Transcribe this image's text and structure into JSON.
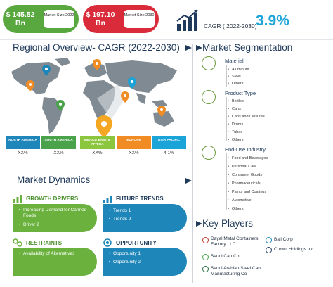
{
  "top": {
    "size_2022": {
      "value": "$ 145.52 Bn",
      "label": "Market Size 2022"
    },
    "size_2030": {
      "value": "$ 197.10 Bn",
      "label": "Market Size 2030"
    },
    "cagr_label": "CAGR ( 2022-2030)",
    "cagr_value": "3.9%"
  },
  "regional": {
    "title": "Regional Overview- CAGR (2022-2030)",
    "regions": [
      {
        "name": "NORTH AMERICA",
        "value": "XX%",
        "color": "#1e86b8"
      },
      {
        "name": "SOUTH AMERICA",
        "value": "XX%",
        "color": "#4aa24b"
      },
      {
        "name": "MIDDLE EAST & AFRICA",
        "value": "XX%",
        "color": "#8cc63f"
      },
      {
        "name": "EUROPE",
        "value": "XX%",
        "color": "#f08c23"
      },
      {
        "name": "ASIA PACIFIC",
        "value": "4.1%",
        "color": "#1aa4d8"
      }
    ]
  },
  "dynamics": {
    "title": "Market Dynamics",
    "growth_drivers": {
      "title": "GROWTH DRIVERS",
      "items": [
        "Increasing Demand for Canned Foods",
        "Driver 2"
      ],
      "color": "#6bb13e"
    },
    "future_trends": {
      "title": "FUTURE TRENDS",
      "items": [
        "Trends 1",
        "Trends 2"
      ],
      "color": "#1e86b8"
    },
    "restraints": {
      "title": "RESTRAINTS",
      "items": [
        "Availability of Alternatives"
      ],
      "color": "#6bb13e"
    },
    "opportunity": {
      "title": "OPPORTUNITY",
      "items": [
        "Opportunity 1",
        "Opportunity 2"
      ],
      "color": "#1e86b8"
    }
  },
  "segmentation": {
    "title": "Market Segmentation",
    "groups": [
      {
        "name": "Material",
        "items": [
          "Aluminum",
          "Steel",
          "Others"
        ]
      },
      {
        "name": "Product Type",
        "items": [
          "Bottles",
          "Cans",
          "Caps and Closures",
          "Drums",
          "Tubes",
          "Others"
        ]
      },
      {
        "name": "End-Use Industry",
        "items": [
          "Food and Beverages",
          "Personal Care",
          "Consumer Goods",
          "Pharmaceuticals",
          "Paints and Coatings",
          "Automotive",
          "Others"
        ]
      }
    ]
  },
  "key_players": {
    "title": "Key Players",
    "players": [
      "Dayal Metal Containers Factory LLC",
      "Ball Corp",
      "Saudi Can Co",
      "Crown Holdings Inc",
      "Saudi Arabian Steel Can Manufacturing Co"
    ]
  },
  "colors": {
    "accent_blue": "#1aa4d8",
    "accent_green": "#6bb13e",
    "title_navy": "#1f3a5a",
    "map_gray": "#7f8a92",
    "pin_orange": "#f08c23"
  }
}
